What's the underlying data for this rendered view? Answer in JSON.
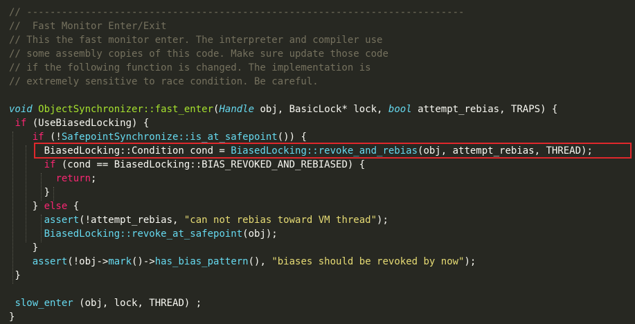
{
  "editor": {
    "lines": [
      {
        "segments": [
          {
            "t": "// ---------------------------------------------------------------------------",
            "c": "cmt"
          }
        ]
      },
      {
        "segments": [
          {
            "t": "//  Fast Monitor Enter/Exit",
            "c": "cmt"
          }
        ]
      },
      {
        "segments": [
          {
            "t": "// This the fast monitor enter. The interpreter and compiler use",
            "c": "cmt"
          }
        ]
      },
      {
        "segments": [
          {
            "t": "// some assembly copies of this code. Make sure update those code",
            "c": "cmt"
          }
        ]
      },
      {
        "segments": [
          {
            "t": "// if the following function is changed. The implementation is",
            "c": "cmt"
          }
        ]
      },
      {
        "segments": [
          {
            "t": "// extremely sensitive to race condition. Be careful.",
            "c": "cmt"
          }
        ]
      },
      {
        "segments": []
      },
      {
        "segments": [
          {
            "t": "void",
            "c": "ty"
          },
          {
            "t": " ",
            "c": "id"
          },
          {
            "t": "ObjectSynchronizer::fast_enter",
            "c": "fn"
          },
          {
            "t": "(",
            "c": "id"
          },
          {
            "t": "Handle",
            "c": "ty"
          },
          {
            "t": " obj, BasicLock* lock, ",
            "c": "id"
          },
          {
            "t": "bool",
            "c": "ty"
          },
          {
            "t": " attempt_rebias, TRAPS) {",
            "c": "id"
          }
        ]
      },
      {
        "segments": [
          {
            "t": " ",
            "c": "id"
          },
          {
            "t": "if",
            "c": "kw"
          },
          {
            "t": " (UseBiasedLocking) {",
            "c": "id"
          }
        ]
      },
      {
        "segments": [
          {
            "t": "    ",
            "c": "id"
          },
          {
            "t": "if",
            "c": "kw"
          },
          {
            "t": " (!",
            "c": "id"
          },
          {
            "t": "SafepointSynchronize::is_at_safepoint",
            "c": "cls"
          },
          {
            "t": "()) {",
            "c": "id"
          }
        ]
      },
      {
        "segments": [
          {
            "t": "      BiasedLocking::Condition cond = ",
            "c": "id"
          },
          {
            "t": "BiasedLocking::revoke_and_rebias",
            "c": "cls"
          },
          {
            "t": "(obj, attempt_rebias, THREAD);",
            "c": "id"
          }
        ]
      },
      {
        "segments": [
          {
            "t": "      ",
            "c": "id"
          },
          {
            "t": "if",
            "c": "kw"
          },
          {
            "t": " (cond == BiasedLocking::BIAS_REVOKED_AND_REBIASED) {",
            "c": "id"
          }
        ]
      },
      {
        "segments": [
          {
            "t": "        ",
            "c": "id"
          },
          {
            "t": "return",
            "c": "kw"
          },
          {
            "t": ";",
            "c": "id"
          }
        ]
      },
      {
        "segments": [
          {
            "t": "      }",
            "c": "id"
          }
        ]
      },
      {
        "segments": [
          {
            "t": "    } ",
            "c": "id"
          },
          {
            "t": "else",
            "c": "kw"
          },
          {
            "t": " {",
            "c": "id"
          }
        ]
      },
      {
        "segments": [
          {
            "t": "      ",
            "c": "id"
          },
          {
            "t": "assert",
            "c": "cls"
          },
          {
            "t": "(!attempt_rebias, ",
            "c": "id"
          },
          {
            "t": "\"can not rebias toward VM thread\"",
            "c": "str"
          },
          {
            "t": ");",
            "c": "id"
          }
        ]
      },
      {
        "segments": [
          {
            "t": "      ",
            "c": "id"
          },
          {
            "t": "BiasedLocking::revoke_at_safepoint",
            "c": "cls"
          },
          {
            "t": "(obj);",
            "c": "id"
          }
        ]
      },
      {
        "segments": [
          {
            "t": "    }",
            "c": "id"
          }
        ]
      },
      {
        "segments": [
          {
            "t": "    ",
            "c": "id"
          },
          {
            "t": "assert",
            "c": "cls"
          },
          {
            "t": "(!obj->",
            "c": "id"
          },
          {
            "t": "mark",
            "c": "cls"
          },
          {
            "t": "()->",
            "c": "id"
          },
          {
            "t": "has_bias_pattern",
            "c": "cls"
          },
          {
            "t": "(), ",
            "c": "id"
          },
          {
            "t": "\"biases should be revoked by now\"",
            "c": "str"
          },
          {
            "t": ");",
            "c": "id"
          }
        ]
      },
      {
        "segments": [
          {
            "t": " }",
            "c": "id"
          }
        ]
      },
      {
        "segments": []
      },
      {
        "segments": [
          {
            "t": " ",
            "c": "id"
          },
          {
            "t": "slow_enter",
            "c": "cls"
          },
          {
            "t": " (obj, lock, THREAD) ;",
            "c": "id"
          }
        ]
      },
      {
        "segments": [
          {
            "t": "}",
            "c": "id"
          }
        ]
      }
    ],
    "highlighted_line_index": 10,
    "colors": {
      "background": "#272822",
      "comment": "#75715e",
      "keyword": "#f92672",
      "type": "#66d9ef",
      "function": "#a6e22e",
      "string": "#e6db74",
      "highlight_border": "#e0282c"
    }
  }
}
